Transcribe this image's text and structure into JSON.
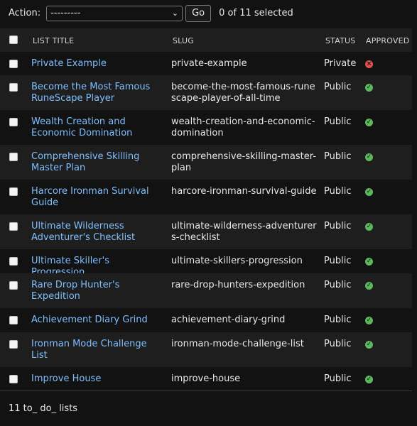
{
  "actions": {
    "label": "Action:",
    "select_value": "---------",
    "go_label": "Go",
    "counter": "0 of 11 selected"
  },
  "table": {
    "headers": [
      "LIST TITLE",
      "SLUG",
      "STATUS",
      "APPROVED"
    ],
    "rows": [
      {
        "title": "Private Example",
        "slug": "private-example",
        "status": "Private",
        "approved": false
      },
      {
        "title": "Become the Most Famous RuneScape Player",
        "slug": "become-the-most-famous-runescape-player-of-all-time",
        "status": "Public",
        "approved": true
      },
      {
        "title": "Wealth Creation and Economic Domination",
        "slug": "wealth-creation-and-economic-domination",
        "status": "Public",
        "approved": true
      },
      {
        "title": "Comprehensive Skilling Master Plan",
        "slug": "comprehensive-skilling-master-plan",
        "status": "Public",
        "approved": true
      },
      {
        "title": "Harcore Ironman Survival Guide",
        "slug": "harcore-ironman-survival-guide",
        "status": "Public",
        "approved": true
      },
      {
        "title": "Ultimate Wilderness Adventurer's Checklist",
        "slug": "ultimate-wilderness-adventurers-checklist",
        "status": "Public",
        "approved": true
      },
      {
        "title": "Ultimate Skiller's Progression",
        "slug": "ultimate-skillers-progression",
        "status": "Public",
        "approved": true
      },
      {
        "title": "Rare Drop Hunter's Expedition",
        "slug": "rare-drop-hunters-expedition",
        "status": "Public",
        "approved": true
      },
      {
        "title": "Achievement Diary Grind",
        "slug": "achievement-diary-grind",
        "status": "Public",
        "approved": true
      },
      {
        "title": "Ironman Mode Challenge List",
        "slug": "ironman-mode-challenge-list",
        "status": "Public",
        "approved": true
      },
      {
        "title": "Improve House",
        "slug": "improve-house",
        "status": "Public",
        "approved": true
      }
    ]
  },
  "footer": {
    "text": "11 to_ do_ lists"
  },
  "icons": {
    "approved_true": "check-circle-icon",
    "approved_false": "x-circle-icon",
    "select_arrow": "chevron-down-icon"
  },
  "colors": {
    "link": "#7fbfff",
    "approved": "#5cb85c",
    "rejected": "#e05050",
    "background": "#121212",
    "row_alt": "#1e1e1e"
  }
}
